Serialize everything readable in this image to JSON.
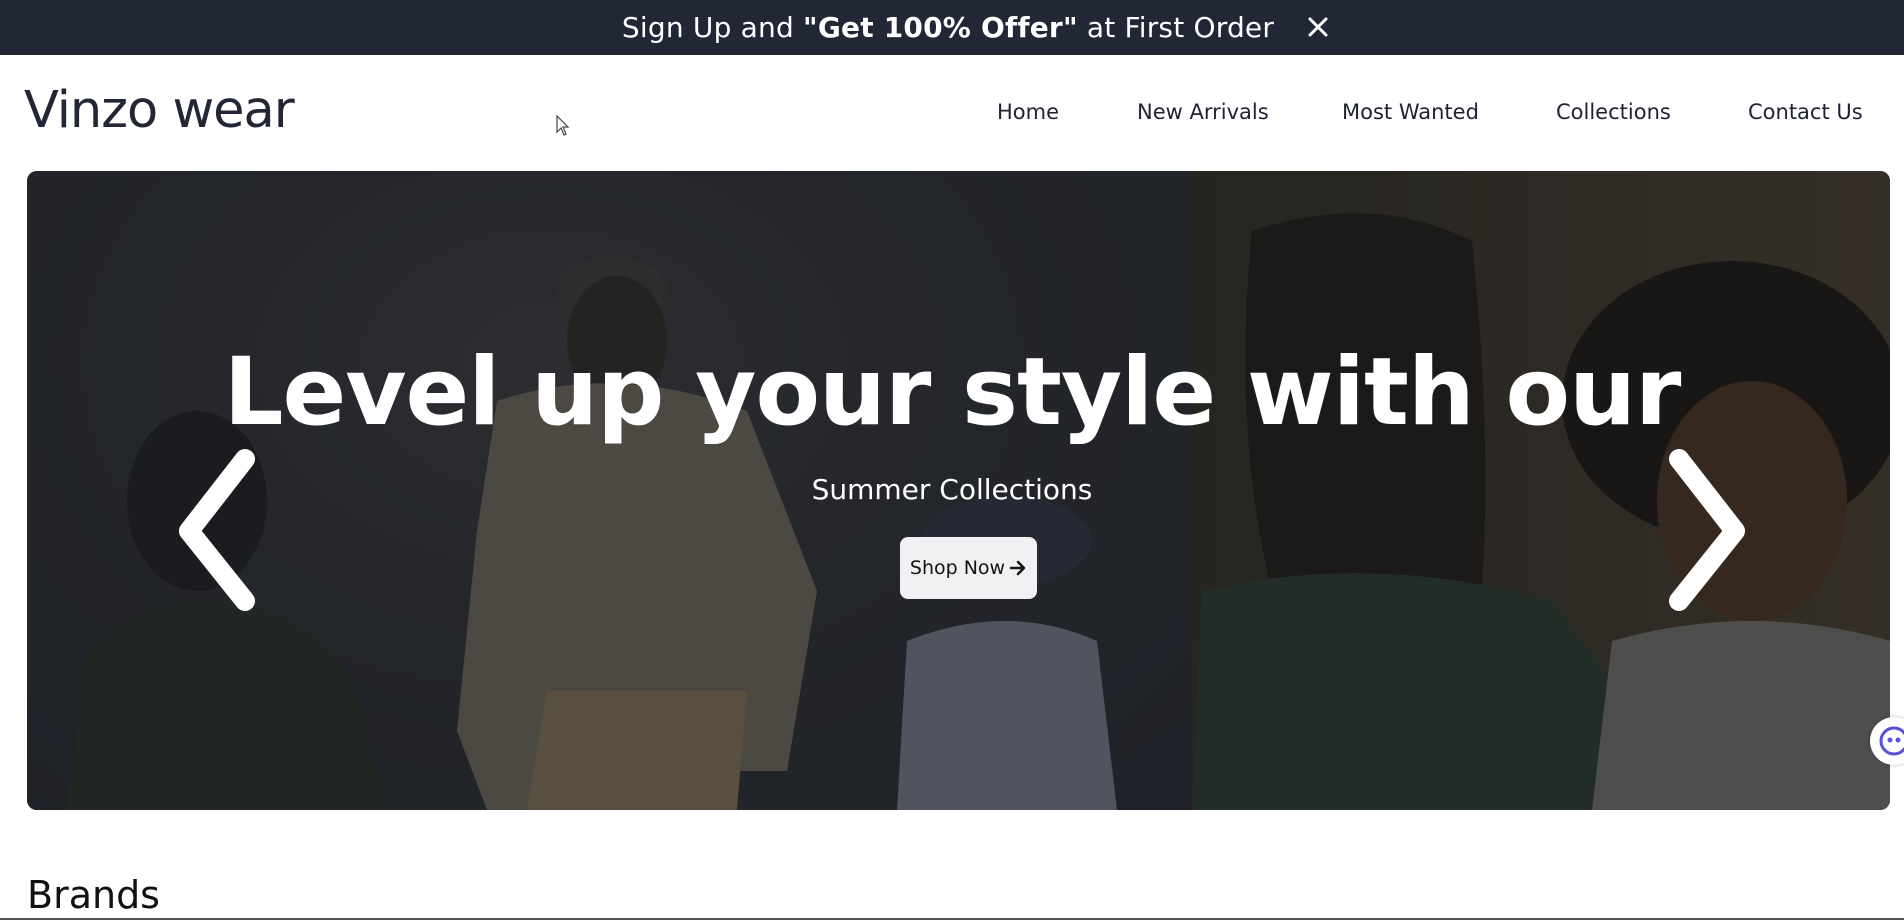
{
  "promo": {
    "text_before": "Sign Up and ",
    "text_bold": "\"Get 100% Offer\"",
    "text_after": " at First Order",
    "close_icon": "close-icon"
  },
  "header": {
    "logo": "Vinzo wear",
    "nav": [
      "Home",
      "New Arrivals",
      "Most Wanted",
      "Collections",
      "Contact Us"
    ]
  },
  "hero": {
    "title": "Level up your style with our",
    "subtitle": "Summer Collections",
    "cta_label": "Shop Now",
    "prev_icon": "chevron-left-icon",
    "next_icon": "chevron-right-icon"
  },
  "sections": {
    "brands_heading": "Brands"
  },
  "colors": {
    "promo_bg": "#222736",
    "button_bg": "#f1f1f3",
    "text_dark": "#1f2230"
  }
}
